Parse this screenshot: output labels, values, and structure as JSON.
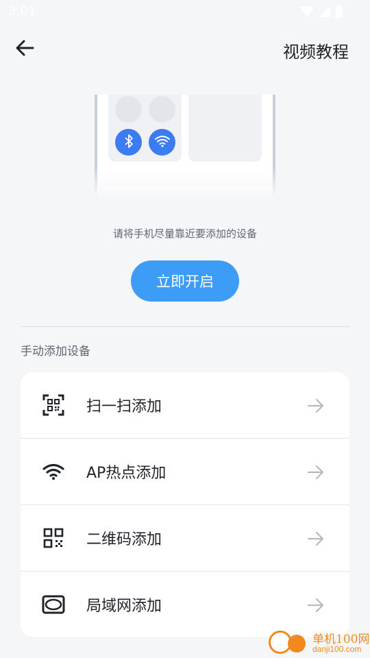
{
  "status_bar": {
    "time": "3:01"
  },
  "header": {
    "video_tutorial": "视频教程"
  },
  "hint": "请将手机尽量靠近要添加的设备",
  "primary_button": "立即开启",
  "section_title": "手动添加设备",
  "options": [
    {
      "label": "扫一扫添加",
      "icon": "scan-icon"
    },
    {
      "label": "AP热点添加",
      "icon": "wifi-icon"
    },
    {
      "label": "二维码添加",
      "icon": "qr-code-icon"
    },
    {
      "label": "局域网添加",
      "icon": "lan-icon"
    }
  ],
  "watermark": {
    "name": "单机100网",
    "url": "danji100.com"
  },
  "colors": {
    "accent": "#3d9cf5",
    "bluetooth_wifi": "#3c7cf2",
    "watermark": "#f08a1e"
  }
}
